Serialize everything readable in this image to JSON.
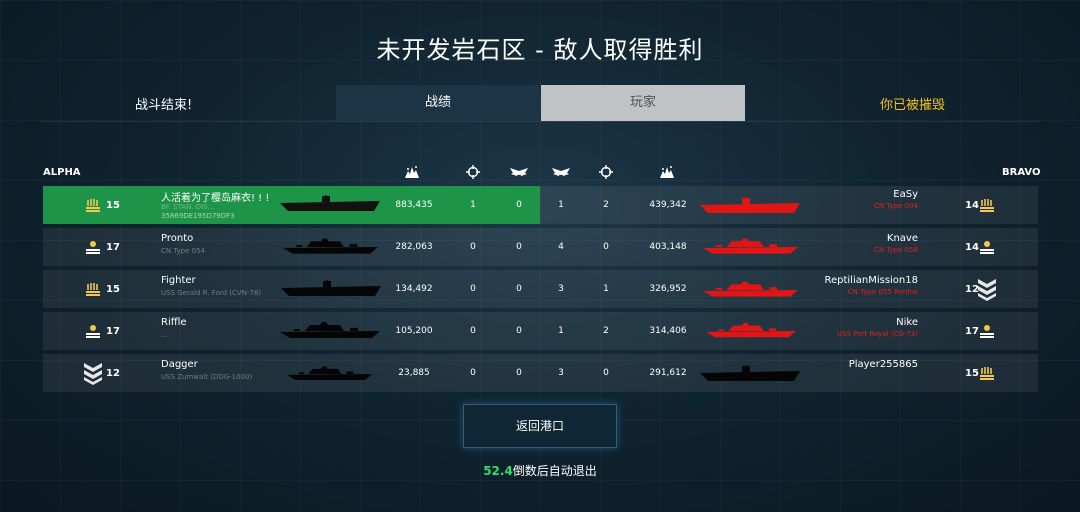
{
  "title": "未开发岩石区 - 敌人取得胜利",
  "header": {
    "battle_over": "战斗结束!",
    "tab_stats": "战绩",
    "tab_players": "玩家",
    "destroyed": "你已被摧毁"
  },
  "teams": {
    "alpha": "ALPHA",
    "bravo": "BRAVO"
  },
  "icons": {
    "columns": [
      "explosion-icon",
      "crosshair-icon",
      "wings-icon",
      "wings-icon",
      "crosshair-icon",
      "explosion-icon"
    ],
    "rank_colors": {
      "gold": "#f2c94c",
      "white": "#ffffff"
    }
  },
  "rows": [
    {
      "alpha_rank": "15",
      "alpha_name": "人活着为了樱岛麻衣! ! !",
      "alpha_ship": "BF. STAN. DIS...",
      "alpha_id": "35869DE195D79DF3",
      "alpha_score": "883,435",
      "a1": "1",
      "a2": "0",
      "b1": "1",
      "b2": "2",
      "bravo_score": "439,342",
      "bravo_name": "EaSy",
      "bravo_ship": "CN Type 004",
      "bravo_rank": "14"
    },
    {
      "alpha_rank": "17",
      "alpha_name": "Pronto",
      "alpha_ship": "CN Type 054",
      "alpha_score": "282,063",
      "a1": "0",
      "a2": "0",
      "b1": "4",
      "b2": "0",
      "bravo_score": "403,148",
      "bravo_name": "Knave",
      "bravo_ship": "CN Type 058",
      "bravo_rank": "14"
    },
    {
      "alpha_rank": "15",
      "alpha_name": "Fighter",
      "alpha_ship": "USS Gerald R. Ford (CVN-78)",
      "alpha_score": "134,492",
      "a1": "0",
      "a2": "0",
      "b1": "3",
      "b2": "1",
      "bravo_score": "326,952",
      "bravo_name": "ReptilianMission18",
      "bravo_ship": "CN Type 055 Renhai",
      "bravo_rank": "12"
    },
    {
      "alpha_rank": "17",
      "alpha_name": "Riffle",
      "alpha_ship": "...",
      "alpha_score": "105,200",
      "a1": "0",
      "a2": "0",
      "b1": "1",
      "b2": "2",
      "bravo_score": "314,406",
      "bravo_name": "Nike",
      "bravo_ship": "USS Port Royal (CG-73)",
      "bravo_rank": "17"
    },
    {
      "alpha_rank": "12",
      "alpha_name": "Dagger",
      "alpha_ship": "USS Zumwalt (DDG-1000)",
      "alpha_score": "23,885",
      "a1": "0",
      "a2": "0",
      "b1": "3",
      "b2": "0",
      "bravo_score": "291,612",
      "bravo_name": "Player255865",
      "bravo_ship": "",
      "bravo_rank": "15"
    }
  ],
  "return_button": "返回港口",
  "countdown": {
    "seconds": "52.4",
    "text": "倒数后自动退出"
  }
}
